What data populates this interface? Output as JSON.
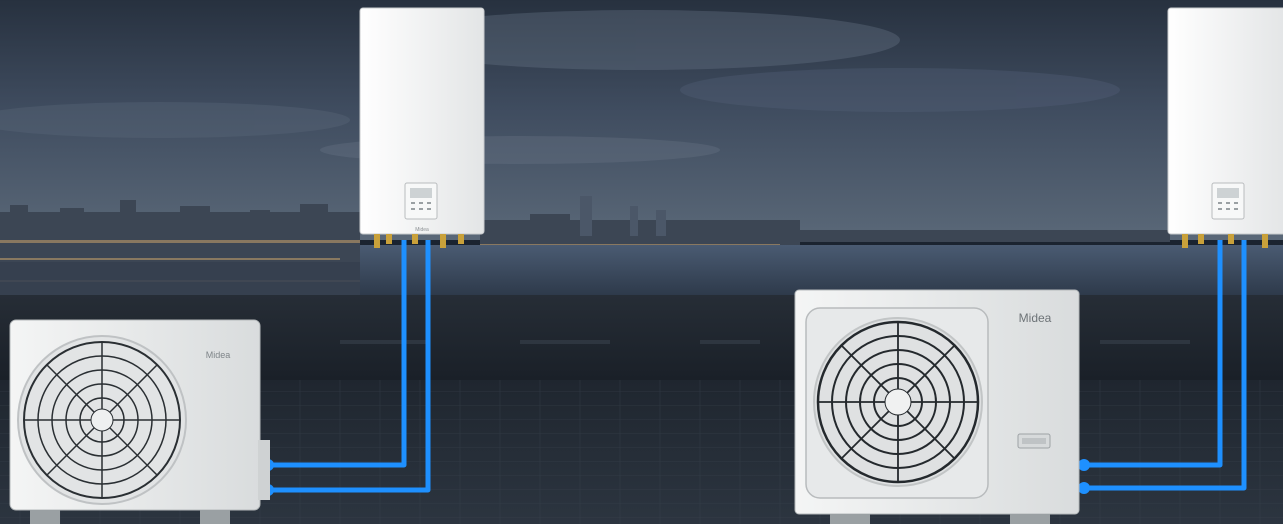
{
  "scene": {
    "brand_label": "Midea",
    "icons": [
      "midea-logo-icon",
      "fan-grille-icon",
      "controller-display-icon"
    ],
    "colors": {
      "pipe": "#1e90ff",
      "sky_top": "#2b3747",
      "sky_mid": "#4a5a70",
      "water": "#3a4a60",
      "roof": "#1c232c",
      "unit_body": "#eef0f0"
    }
  }
}
